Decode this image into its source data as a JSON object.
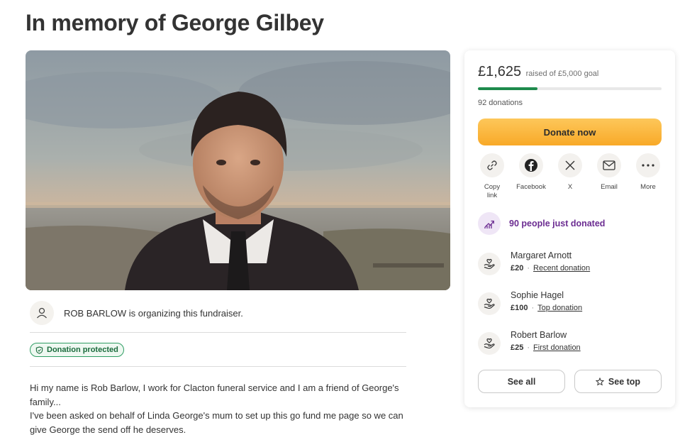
{
  "page": {
    "title": "In memory of George Gilbey"
  },
  "organizer": {
    "text": "ROB BARLOW is organizing this fundraiser."
  },
  "badge": {
    "label": "Donation protected"
  },
  "story": {
    "lines": [
      "Hi my name is Rob Barlow, I work for Clacton funeral service and I am a friend of George's family...",
      "I've been asked on behalf of Linda George's mum to set up this go fund me page so we can give George the send off he deserves."
    ]
  },
  "card": {
    "raised": "£1,625",
    "goal_text": "raised of £5,000 goal",
    "progress_fraction": 0.325,
    "donation_count": "92 donations",
    "donate_label": "Donate now",
    "share": [
      {
        "label": "Copy link",
        "icon": "link-icon"
      },
      {
        "label": "Facebook",
        "icon": "facebook-icon"
      },
      {
        "label": "X",
        "icon": "x-icon"
      },
      {
        "label": "Email",
        "icon": "email-icon"
      },
      {
        "label": "More",
        "icon": "more-icon"
      }
    ],
    "just_donated": "90 people just donated",
    "donors": [
      {
        "name": "Margaret Arnott",
        "amount": "£20",
        "tag": "Recent donation"
      },
      {
        "name": "Sophie Hagel",
        "amount": "£100",
        "tag": "Top donation"
      },
      {
        "name": "Robert Barlow",
        "amount": "£25",
        "tag": "First donation"
      }
    ],
    "see_all_label": "See all",
    "see_top_label": "See top"
  },
  "colors": {
    "accent_green": "#1e8a4c",
    "donate_orange": "#f8a928",
    "purple": "#6b2c91"
  }
}
